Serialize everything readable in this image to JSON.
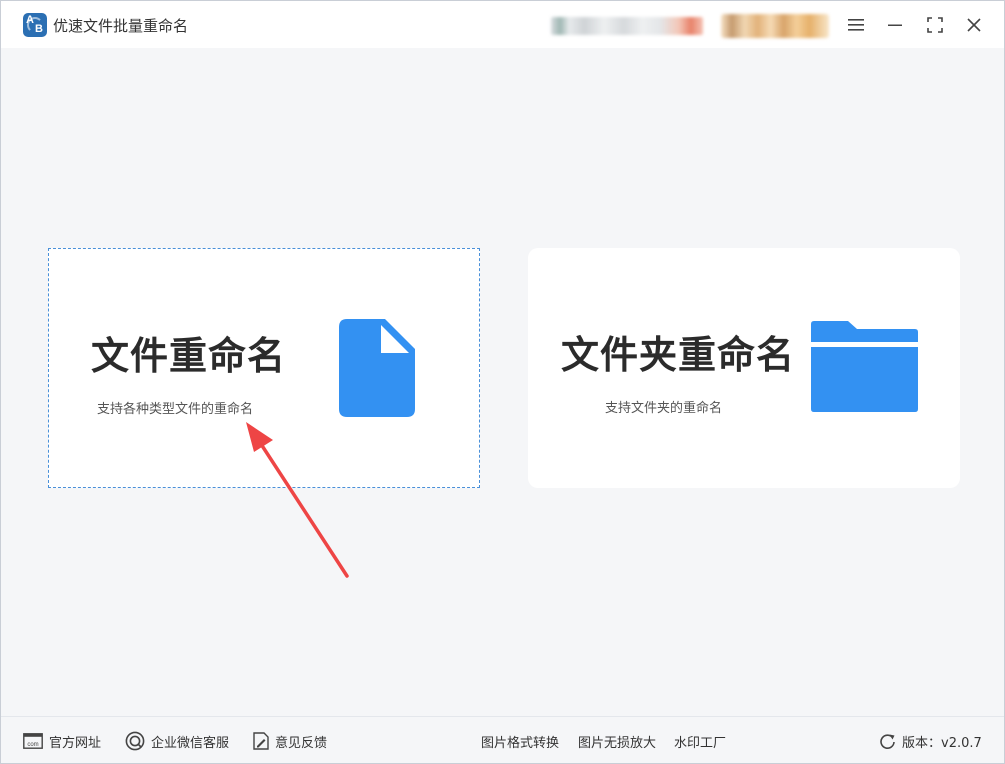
{
  "app": {
    "title": "优速文件批量重命名",
    "logo_letters": [
      "A",
      "B"
    ]
  },
  "titlebar": {
    "icons": [
      "menu-icon",
      "minimize-icon",
      "maximize-icon",
      "close-icon"
    ]
  },
  "cards": {
    "file": {
      "title": "文件重命名",
      "desc": "支持各种类型文件的重命名",
      "icon": "file-icon"
    },
    "folder": {
      "title": "文件夹重命名",
      "desc": "支持文件夹的重命名",
      "icon": "folder-icon"
    }
  },
  "footer": {
    "site": {
      "label": "官方网址",
      "icon": "website-icon",
      "icon_text": "com"
    },
    "wechat": {
      "label": "企业微信客服",
      "icon": "chat-icon"
    },
    "feedback": {
      "label": "意见反馈",
      "icon": "feedback-icon"
    },
    "convert": {
      "label": "图片格式转换"
    },
    "enlarge": {
      "label": "图片无损放大"
    },
    "watermark": {
      "label": "水印工厂"
    },
    "version": {
      "label": "版本：v2.0.7",
      "icon": "refresh-icon"
    }
  },
  "colors": {
    "accent": "#3391f2",
    "selection_border": "#4a90d9",
    "arrow": "#ee4545",
    "background": "#f5f6f8",
    "card": "#ffffff"
  }
}
